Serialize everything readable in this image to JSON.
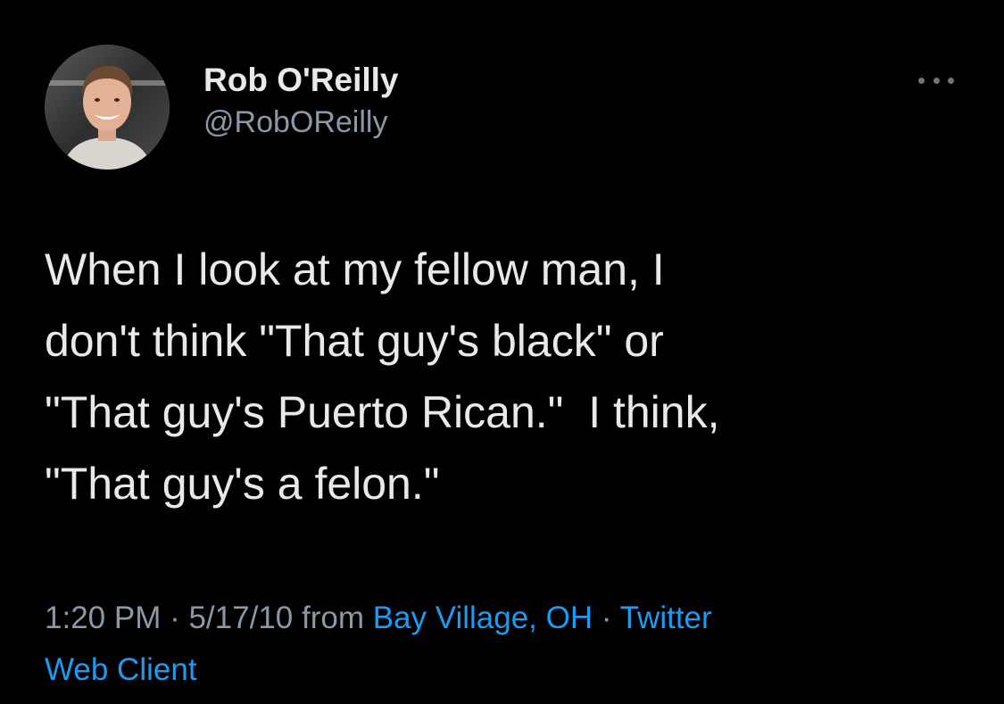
{
  "author": {
    "display_name": "Rob O'Reilly",
    "handle": "@RobOReilly"
  },
  "icons": {
    "more": "more-horizontal-icon",
    "avatar": "profile-photo"
  },
  "tweet": {
    "lines": [
      "When I look at my fellow man, I",
      "don't think \"That guy's black\" or",
      "\"That guy's Puerto Rican.\"  I think,",
      "\"That guy's a felon.\""
    ]
  },
  "meta": {
    "time": "1:20 PM",
    "sep1": " · ",
    "date": "5/17/10",
    "from": " from ",
    "location": "Bay Village, OH",
    "sep2": " · ",
    "source_part1": "Twitter",
    "source_part2": "Web Client"
  },
  "colors": {
    "background": "#000000",
    "text": "#e7e9ea",
    "secondary": "#8b98a5",
    "link": "#1d9bf0"
  }
}
